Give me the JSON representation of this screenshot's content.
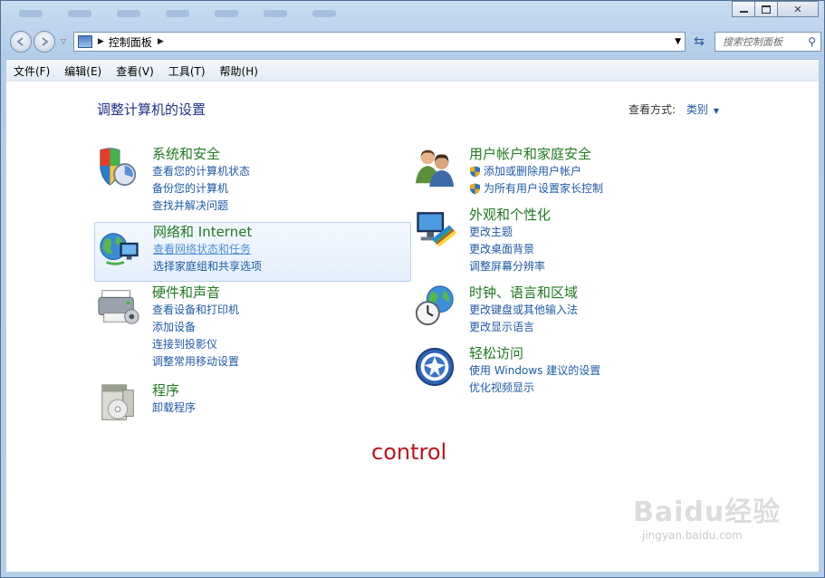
{
  "window": {
    "caption": {
      "minimize": "minimize-icon",
      "maximize": "maximize-icon",
      "close_glyph": "✕"
    }
  },
  "navigation": {
    "breadcrumb_root_icon": "control-panel-icon",
    "breadcrumb": [
      "控制面板"
    ],
    "search_placeholder": "搜索控制面板"
  },
  "menu": [
    "文件(F)",
    "编辑(E)",
    "查看(V)",
    "工具(T)",
    "帮助(H)"
  ],
  "page": {
    "heading": "调整计算机的设置",
    "view_by_label": "查看方式:",
    "view_by_value": "类别"
  },
  "categories_left": [
    {
      "title": "系统和安全",
      "icon": "system-security-icon",
      "links": [
        "查看您的计算机状态",
        "备份您的计算机",
        "查找并解决问题"
      ]
    },
    {
      "title": "网络和 Internet",
      "icon": "network-internet-icon",
      "links": [
        "查看网络状态和任务",
        "选择家庭组和共享选项"
      ]
    },
    {
      "title": "硬件和声音",
      "icon": "hardware-sound-icon",
      "links": [
        "查看设备和打印机",
        "添加设备",
        "连接到投影仪",
        "调整常用移动设置"
      ]
    },
    {
      "title": "程序",
      "icon": "programs-icon",
      "links": [
        "卸载程序"
      ]
    }
  ],
  "categories_right": [
    {
      "title": "用户帐户和家庭安全",
      "icon": "user-accounts-icon",
      "links": [
        "添加或删除用户帐户",
        "为所有用户设置家长控制"
      ]
    },
    {
      "title": "外观和个性化",
      "icon": "appearance-icon",
      "links": [
        "更改主题",
        "更改桌面背景",
        "调整屏幕分辨率"
      ]
    },
    {
      "title": "时钟、语言和区域",
      "icon": "clock-language-icon",
      "links": [
        "更改键盘或其他输入法",
        "更改显示语言"
      ]
    },
    {
      "title": "轻松访问",
      "icon": "ease-of-access-icon",
      "links": [
        "使用 Windows 建议的设置",
        "优化视频显示"
      ]
    }
  ],
  "annotation": "control",
  "watermark": {
    "main": "Baidu经验",
    "sub": "jingyan.baidu.com"
  },
  "colors": {
    "category_title": "#1f7a1f",
    "link": "#1e5aa8",
    "annotation": "#c0121c"
  }
}
